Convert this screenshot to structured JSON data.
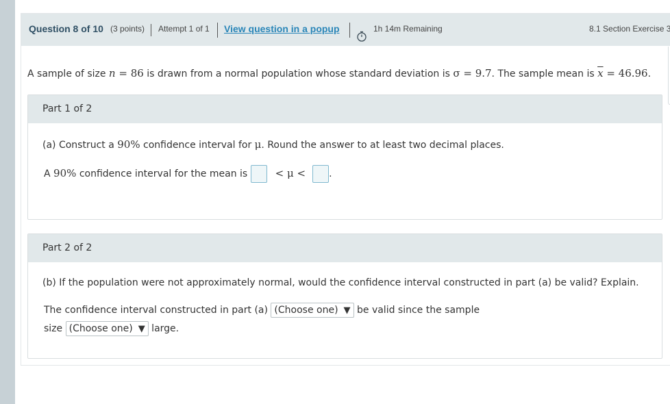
{
  "header": {
    "question": "Question 8 of 10",
    "points": "(3 points)",
    "attempt": "Attempt 1 of 1",
    "popup_link": "View question in a popup",
    "remaining": "1h 14m Remaining",
    "section": "8.1 Section Exercise 3"
  },
  "problem": {
    "t1": "A sample of size ",
    "n_var": "n",
    "n_eq": " = 86",
    "t2": " is drawn from a normal population whose standard deviation is ",
    "sigma": "σ = 9.7",
    "t3": ". The sample mean is ",
    "xbar": "x",
    "mean_eq": " = 46.96",
    "t4": "."
  },
  "part1": {
    "title": "Part 1 of 2",
    "q_a": "(a) Construct a ",
    "q_pct": "90%",
    "q_b": " confidence interval for ",
    "q_mu": "μ",
    "q_c": ". Round the answer to at least two decimal places.",
    "ans_a": "A ",
    "ans_pct": "90%",
    "ans_b": " confidence interval for the mean is ",
    "ineq": "< μ <",
    "end": "."
  },
  "part2": {
    "title": "Part 2 of 2",
    "question": "(b) If the population were not approximately normal, would the confidence interval constructed in part (a) be valid? Explain.",
    "l1a": "The confidence interval constructed in part (a) ",
    "select1": "(Choose one)",
    "l1b": " be valid since the sample",
    "l2a": "size ",
    "select2": "(Choose one)",
    "l2b": " large."
  },
  "icons": {
    "timer": "stopwatch-icon",
    "dropdown": "triangle-down-icon"
  }
}
